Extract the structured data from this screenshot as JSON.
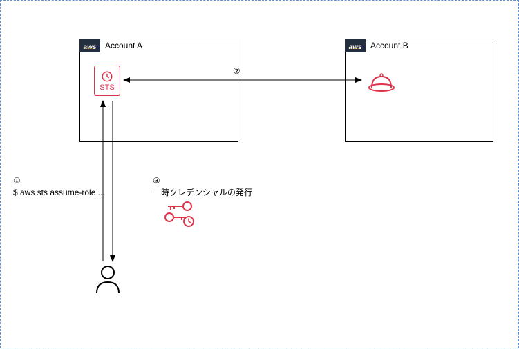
{
  "accountA": {
    "title": "Account A"
  },
  "accountB": {
    "title": "Account B"
  },
  "sts": {
    "label": "STS"
  },
  "aws_badge_text": "aws",
  "labels": {
    "step1_num": "①",
    "step1_cmd": "$ aws sts assume-role ...",
    "step2_num": "②",
    "step3_num": "③",
    "step3_text": "一時クレデンシャルの発行"
  }
}
